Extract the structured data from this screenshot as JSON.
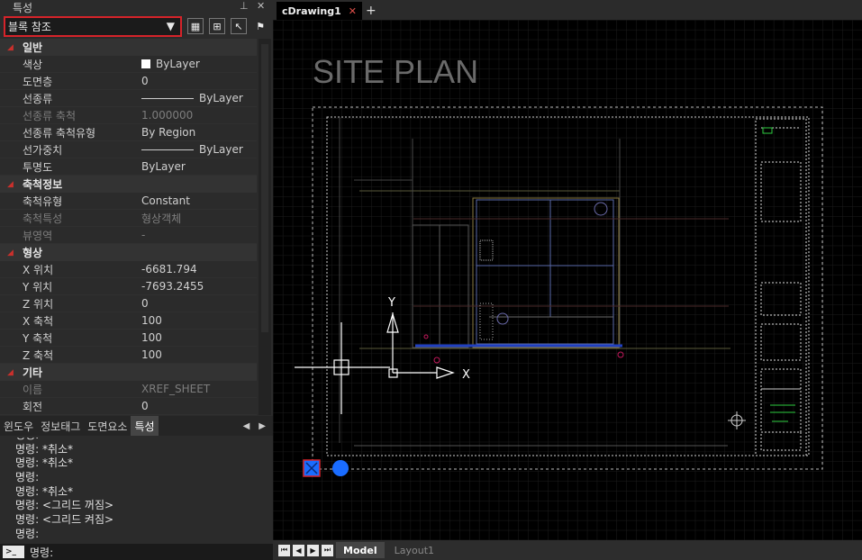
{
  "panel": {
    "title": "특성",
    "pin_glyph": "⊥",
    "close_glyph": "✕",
    "selector_value": "블록 참조",
    "categories": [
      {
        "label": "일반",
        "rows": [
          {
            "key": "색상",
            "value": "ByLayer",
            "swatch": "#ffffff",
            "dim": false
          },
          {
            "key": "도면층",
            "value": "0",
            "dim": false
          },
          {
            "key": "선종류",
            "value": "ByLayer",
            "line": true,
            "dim": false
          },
          {
            "key": "선종류 축척",
            "value": "1.000000",
            "dim": true
          },
          {
            "key": "선종류 축척유형",
            "value": "By Region",
            "dim": false
          },
          {
            "key": "선가중치",
            "value": "ByLayer",
            "line": true,
            "dim": false
          },
          {
            "key": "투명도",
            "value": "ByLayer",
            "dim": false
          }
        ]
      },
      {
        "label": "축척정보",
        "rows": [
          {
            "key": "축척유형",
            "value": "Constant",
            "dim": false
          },
          {
            "key": "축척특성",
            "value": "형상객체",
            "dim": true
          },
          {
            "key": "뷰영역",
            "value": "-",
            "dim": true
          }
        ]
      },
      {
        "label": "형상",
        "rows": [
          {
            "key": "X 위치",
            "value": "-6681.794",
            "dim": false
          },
          {
            "key": "Y 위치",
            "value": "-7693.2455",
            "dim": false
          },
          {
            "key": "Z 위치",
            "value": "0",
            "dim": false
          },
          {
            "key": "X 축척",
            "value": "100",
            "dim": false
          },
          {
            "key": "Y 축척",
            "value": "100",
            "dim": false
          },
          {
            "key": "Z 축척",
            "value": "100",
            "dim": false
          }
        ]
      },
      {
        "label": "기타",
        "rows": [
          {
            "key": "이름",
            "value": "XREF_SHEET",
            "dim": true
          },
          {
            "key": "회전",
            "value": "0",
            "dim": false
          }
        ]
      }
    ]
  },
  "panel_tabs": [
    "윈도우",
    "정보태그",
    "도면요소",
    "특성"
  ],
  "panel_tabs_active": 3,
  "command_history": [
    "명령: ",
    "명령: *취소*",
    "명령: *취소*",
    "명령:",
    "명령: *취소*",
    "명령: <그리드 꺼짐>",
    "명령: <그리드 켜짐>",
    "명령:"
  ],
  "command_prompt": "명령:",
  "command_icon": ">_",
  "document_tab": "cDrawing1",
  "document_tab_close": "✕",
  "add_tab_glyph": "+",
  "drawing": {
    "title": "SITE PLAN",
    "ucs_x": "X",
    "ucs_y": "Y"
  },
  "layout_tabs": [
    "Model",
    "Layout1"
  ],
  "layout_active": 0,
  "colors": {
    "highlight_red": "#d6232a",
    "grip_blue": "#1a6cff",
    "grid": "#1a1a1a"
  },
  "icons": [
    "quick-select-icon",
    "select-objects-icon",
    "pick-icon",
    "toggle-pickadd-icon"
  ]
}
